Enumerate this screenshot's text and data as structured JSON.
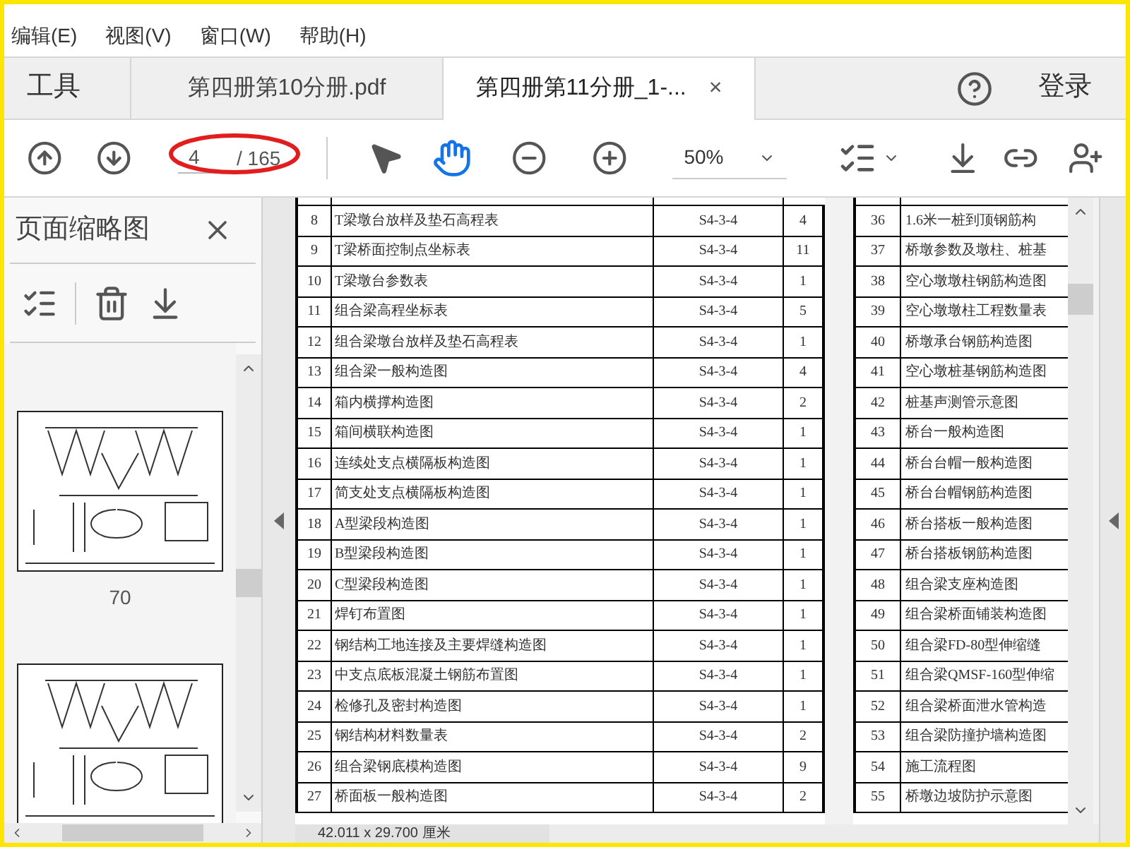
{
  "menu": [
    "编辑(E)",
    "视图(V)",
    "窗口(W)",
    "帮助(H)"
  ],
  "tabs": {
    "tools_label": "工具",
    "documents": [
      {
        "title": "第四册第10分册.pdf",
        "selected": false
      },
      {
        "title": "第四册第11分册_1-...",
        "selected": true,
        "close": "×"
      }
    ],
    "login": "登录"
  },
  "toolbar": {
    "page_number": "4",
    "page_total": "/ 165",
    "zoom": "50%",
    "tools": [
      {
        "kind": "select",
        "selected": false
      },
      {
        "kind": "hand",
        "selected": true
      }
    ]
  },
  "thumbnails_panel": {
    "title": "页面缩略图",
    "pages": [
      {
        "label": "70"
      }
    ]
  },
  "document": {
    "page_size": "42.011 x 29.700 厘米",
    "pages": [
      {
        "rows": [
          {
            "number": "8",
            "name": "T梁墩台放样及垫石高程表",
            "code": "S4-3-4",
            "count": "4"
          },
          {
            "number": "9",
            "name": "T梁桥面控制点坐标表",
            "code": "S4-3-4",
            "count": "11"
          },
          {
            "number": "10",
            "name": "T梁墩台参数表",
            "code": "S4-3-4",
            "count": "1"
          },
          {
            "number": "11",
            "name": "组合梁高程坐标表",
            "code": "S4-3-4",
            "count": "5"
          },
          {
            "number": "12",
            "name": "组合梁墩台放样及垫石高程表",
            "code": "S4-3-4",
            "count": "1"
          },
          {
            "number": "13",
            "name": "组合梁一般构造图",
            "code": "S4-3-4",
            "count": "4"
          },
          {
            "number": "14",
            "name": "箱内横撑构造图",
            "code": "S4-3-4",
            "count": "2"
          },
          {
            "number": "15",
            "name": "箱间横联构造图",
            "code": "S4-3-4",
            "count": "1"
          },
          {
            "number": "16",
            "name": "连续处支点横隔板构造图",
            "code": "S4-3-4",
            "count": "1"
          },
          {
            "number": "17",
            "name": "简支处支点横隔板构造图",
            "code": "S4-3-4",
            "count": "1"
          },
          {
            "number": "18",
            "name": "A型梁段构造图",
            "code": "S4-3-4",
            "count": "1"
          },
          {
            "number": "19",
            "name": "B型梁段构造图",
            "code": "S4-3-4",
            "count": "1"
          },
          {
            "number": "20",
            "name": "C型梁段构造图",
            "code": "S4-3-4",
            "count": "1"
          },
          {
            "number": "21",
            "name": "焊钉布置图",
            "code": "S4-3-4",
            "count": "1"
          },
          {
            "number": "22",
            "name": "钢结构工地连接及主要焊缝构造图",
            "code": "S4-3-4",
            "count": "1"
          },
          {
            "number": "23",
            "name": "中支点底板混凝土钢筋布置图",
            "code": "S4-3-4",
            "count": "1"
          },
          {
            "number": "24",
            "name": "检修孔及密封构造图",
            "code": "S4-3-4",
            "count": "1"
          },
          {
            "number": "25",
            "name": "钢结构材料数量表",
            "code": "S4-3-4",
            "count": "2"
          },
          {
            "number": "26",
            "name": "组合梁钢底模构造图",
            "code": "S4-3-4",
            "count": "9"
          },
          {
            "number": "27",
            "name": "桥面板一般构造图",
            "code": "S4-3-4",
            "count": "2"
          }
        ]
      },
      {
        "rows": [
          {
            "number": "36",
            "name": "1.6米一桩到顶钢筋构"
          },
          {
            "number": "37",
            "name": "桥墩参数及墩柱、桩基"
          },
          {
            "number": "38",
            "name": "空心墩墩柱钢筋构造图"
          },
          {
            "number": "39",
            "name": "空心墩墩柱工程数量表"
          },
          {
            "number": "40",
            "name": "桥墩承台钢筋构造图"
          },
          {
            "number": "41",
            "name": "空心墩桩基钢筋构造图"
          },
          {
            "number": "42",
            "name": "桩基声测管示意图"
          },
          {
            "number": "43",
            "name": "桥台一般构造图"
          },
          {
            "number": "44",
            "name": "桥台台帽一般构造图"
          },
          {
            "number": "45",
            "name": "桥台台帽钢筋构造图"
          },
          {
            "number": "46",
            "name": "桥台搭板一般构造图"
          },
          {
            "number": "47",
            "name": "桥台搭板钢筋构造图"
          },
          {
            "number": "48",
            "name": "组合梁支座构造图"
          },
          {
            "number": "49",
            "name": "组合梁桥面铺装构造图"
          },
          {
            "number": "50",
            "name": "组合梁FD-80型伸缩缝"
          },
          {
            "number": "51",
            "name": "组合梁QMSF-160型伸缩"
          },
          {
            "number": "52",
            "name": "组合梁桥面泄水管构造"
          },
          {
            "number": "53",
            "name": "组合梁防撞护墙构造图"
          },
          {
            "number": "54",
            "name": "施工流程图"
          },
          {
            "number": "55",
            "name": "桥墩边坡防护示意图"
          }
        ]
      }
    ]
  }
}
